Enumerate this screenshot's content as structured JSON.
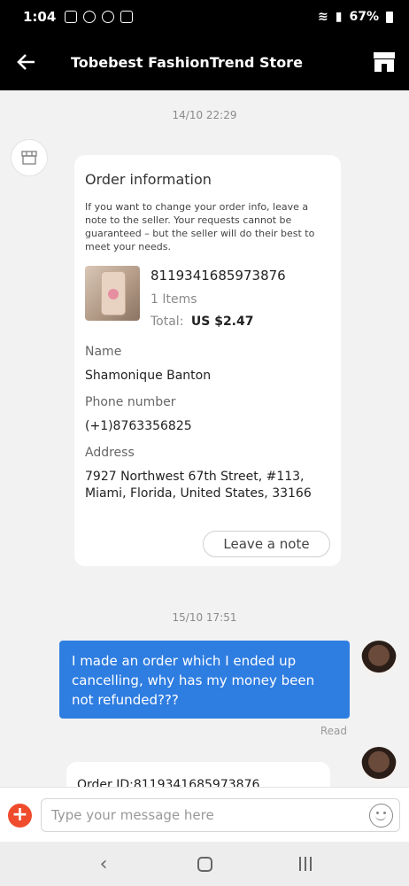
{
  "status_bar": {
    "time": "1:04",
    "battery": "67%"
  },
  "header": {
    "title": "Tobebest FashionTrend Store"
  },
  "chat": {
    "timestamp_1": "14/10 22:29",
    "order_card": {
      "title": "Order information",
      "note": "If you want to change your order info, leave a note to the seller. Your requests cannot be guaranteed – but the seller will do their best to meet your needs.",
      "order_id": "8119341685973876",
      "items": "1 Items",
      "total_label": "Total:",
      "total_value": "US $2.47",
      "name_label": "Name",
      "name_value": "Shamonique Banton",
      "phone_label": "Phone number",
      "phone_value": "(+1)8763356825",
      "address_label": "Address",
      "address_value": "7927 Northwest 67th Street, #113, Miami, Florida, United States, 33166",
      "leave_note": "Leave a note"
    },
    "timestamp_2": "15/10 17:51",
    "message": "I made an order which I ended up cancelling, why has my money been not refunded???",
    "read_status": "Read",
    "order_card_2_text": "Order ID:8119341685973876"
  },
  "composer": {
    "placeholder": "Type your message here"
  },
  "colors": {
    "accent_blue": "#2e7de1",
    "add_red": "#ef4b2d",
    "bar_black": "#000000"
  }
}
